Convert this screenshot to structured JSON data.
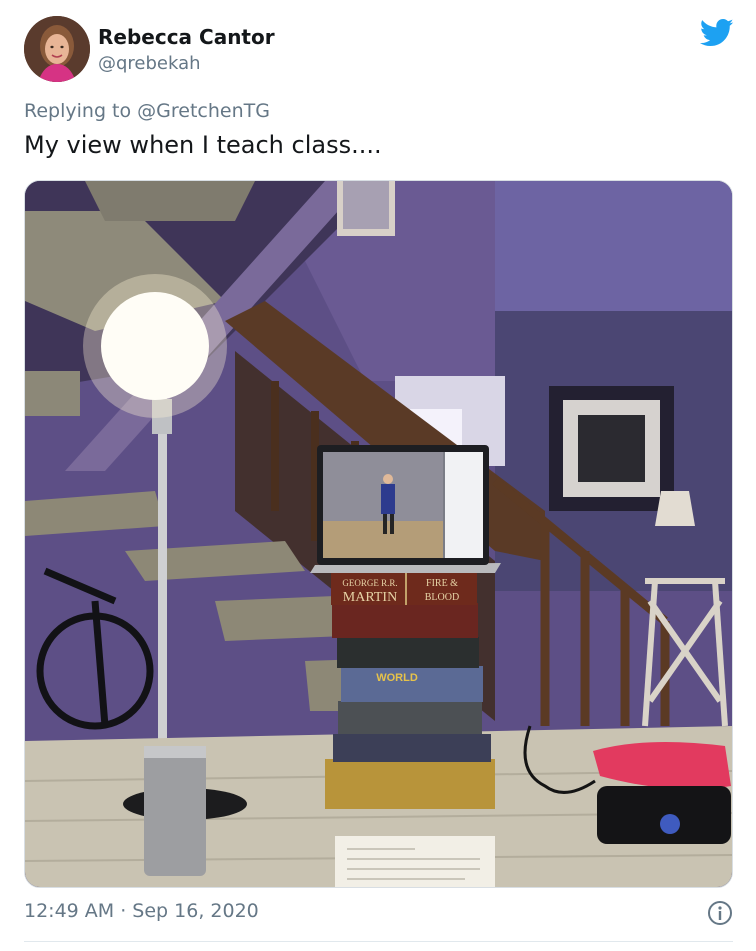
{
  "author": {
    "display_name": "Rebecca Cantor",
    "handle": "@qrebekah"
  },
  "reply": {
    "prefix": "Replying to ",
    "mention": "@GretchenTG"
  },
  "tweet": {
    "text": "My view when I teach class....",
    "timestamp": "12:49 AM · Sep 16, 2020"
  },
  "icons": {
    "brand": "twitter-bird-icon",
    "info": "info-icon"
  },
  "colors": {
    "brand_blue": "#1da1f2",
    "secondary_text": "#657786",
    "primary_text": "#14171a"
  },
  "photo": {
    "book_spines": {
      "top_author_line": "GEORGE R.R.",
      "top_author_name": "MARTIN",
      "top_title_line1": "FIRE &",
      "top_title_line2": "BLOOD",
      "world_label": "WORLD"
    }
  }
}
